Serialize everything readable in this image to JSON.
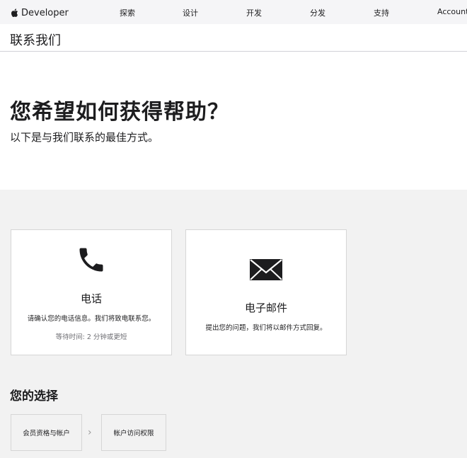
{
  "globalnav": {
    "brand": "Developer",
    "links": [
      "探索",
      "设计",
      "开发",
      "分发",
      "支持",
      "Account"
    ]
  },
  "localnav": {
    "title": "联系我们"
  },
  "hero": {
    "title": "您希望如何获得帮助？",
    "subtitle": "以下是与我们联系的最佳方式。"
  },
  "cards": {
    "phone": {
      "icon": "phone-icon",
      "title": "电话",
      "description": "请确认您的电话信息。我们将致电联系您。",
      "wait": "等待时间: 2 分钟或更短"
    },
    "email": {
      "icon": "envelope-icon",
      "title": "电子邮件",
      "description": "提出您的问题，我们将以邮件方式回复。"
    }
  },
  "selections": {
    "title": "您的选择",
    "items": [
      "会员资格与帐户",
      "帐户访问权限"
    ],
    "separator": "›"
  }
}
